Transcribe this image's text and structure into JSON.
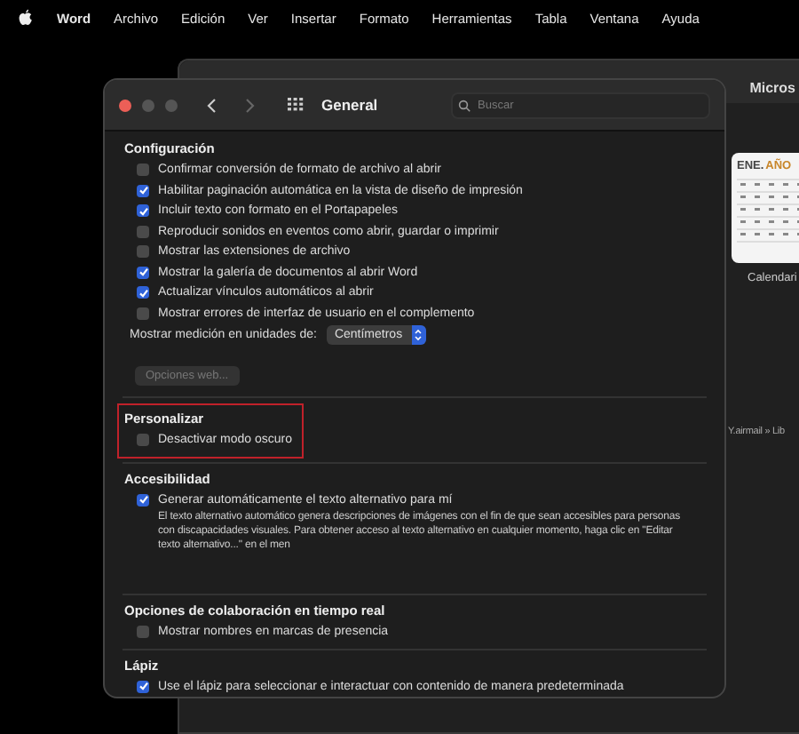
{
  "menu_bar": {
    "app_name": "Word",
    "items": [
      "Archivo",
      "Edición",
      "Ver",
      "Insertar",
      "Formato",
      "Herramientas",
      "Tabla",
      "Ventana",
      "Ayuda"
    ]
  },
  "background_window": {
    "title": "Micros",
    "template": {
      "heading_month": "ENE.",
      "heading_year": "AÑO",
      "label": "Calendari"
    },
    "path": "Y.airmail » Lib"
  },
  "dialog": {
    "title": "General",
    "search": {
      "placeholder": "Buscar"
    },
    "sections": [
      {
        "title": "Configuración",
        "highlighted": false,
        "items": [
          {
            "kind": "checkbox",
            "label": "Confirmar conversión de formato de archivo al abrir",
            "checked": false
          },
          {
            "kind": "checkbox",
            "label": "Habilitar paginación automática en la vista de diseño de impresión",
            "checked": true
          },
          {
            "kind": "checkbox",
            "label": "Incluir texto con formato en el Portapapeles",
            "checked": true
          },
          {
            "kind": "checkbox",
            "label": "Reproducir sonidos en eventos como abrir, guardar o imprimir",
            "checked": false
          },
          {
            "kind": "checkbox",
            "label": "Mostrar las extensiones de archivo",
            "checked": false
          },
          {
            "kind": "checkbox",
            "label": "Mostrar la galería de documentos al abrir Word",
            "checked": true
          },
          {
            "kind": "checkbox",
            "label": "Actualizar vínculos automáticos al abrir",
            "checked": true
          },
          {
            "kind": "checkbox",
            "label": "Mostrar errores de interfaz de usuario en el complemento",
            "checked": false
          },
          {
            "kind": "select",
            "label": "Mostrar medición en unidades de:",
            "value": "Centímetros"
          },
          {
            "kind": "button",
            "label": "Opciones web...",
            "disabled": true
          }
        ]
      },
      {
        "title": "Personalizar",
        "highlighted": true,
        "items": [
          {
            "kind": "checkbox",
            "label": "Desactivar modo oscuro",
            "checked": false
          }
        ]
      },
      {
        "title": "Accesibilidad",
        "highlighted": false,
        "items": [
          {
            "kind": "checkbox",
            "label": "Generar automáticamente el texto alternativo para mí",
            "checked": true
          },
          {
            "kind": "description",
            "label": "El texto alternativo automático genera descripciones de imágenes con el fin de que sean accesibles para personas con discapacidades visuales. Para obtener acceso al texto alternativo en cualquier momento, haga clic en \"Editar texto alternativo...\" en el men"
          }
        ]
      },
      {
        "title": "Opciones de colaboración en tiempo real",
        "highlighted": false,
        "items": [
          {
            "kind": "checkbox",
            "label": "Mostrar nombres en marcas de presencia",
            "checked": false
          }
        ]
      },
      {
        "title": "Lápiz",
        "highlighted": false,
        "items": [
          {
            "kind": "checkbox",
            "label": "Use el lápiz para seleccionar e interactuar con contenido de manera predeterminada",
            "checked": true
          }
        ]
      }
    ]
  }
}
